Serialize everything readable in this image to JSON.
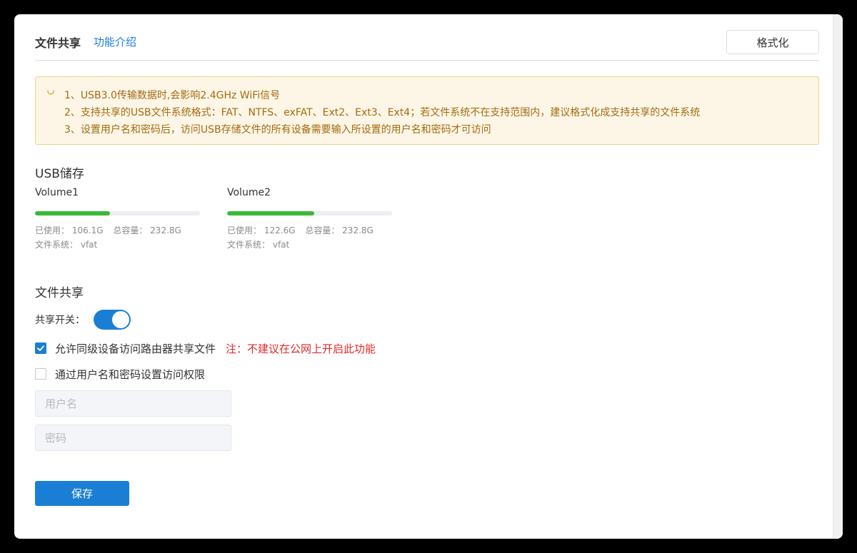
{
  "header": {
    "title": "文件共享",
    "feature_link": "功能介绍",
    "format_button": "格式化"
  },
  "notice": {
    "lines": [
      "1、USB3.0传输数据时,会影响2.4GHz WiFi信号",
      "2、支持共享的USB文件系统格式：FAT、NTFS、exFAT、Ext2、Ext3、Ext4；若文件系统不在支持范围内，建议格式化成支持共享的文件系统",
      "3、设置用户名和密码后，访问USB存储文件的所有设备需要输入所设置的用户名和密码才可访问"
    ]
  },
  "usb": {
    "title": "USB储存",
    "volumes": [
      {
        "name": "Volume1",
        "used_label": "已使用：",
        "used": "106.1G",
        "total_label": "总容量：",
        "total": "232.8G",
        "fs_label": "文件系统：",
        "fs": "vfat",
        "usage_fraction": 0.456
      },
      {
        "name": "Volume2",
        "used_label": "已使用：",
        "used": "122.6G",
        "total_label": "总容量：",
        "total": "232.8G",
        "fs_label": "文件系统：",
        "fs": "vfat",
        "usage_fraction": 0.527
      }
    ]
  },
  "share": {
    "title": "文件共享",
    "switch_label": "共享开关：",
    "switch_on": true,
    "allow_lan_label": "允许同级设备访问路由器共享文件",
    "allow_lan_checked": true,
    "allow_lan_warning": "注：不建议在公网上开启此功能",
    "auth_label": "通过用户名和密码设置访问权限",
    "auth_checked": false,
    "username_placeholder": "用户名",
    "password_placeholder": "密码",
    "save_button": "保存"
  },
  "colors": {
    "accent": "#1a7fd4",
    "usage_bar": "#3bba37",
    "warning": "#e02a2a",
    "notice_text": "#a36b12"
  }
}
